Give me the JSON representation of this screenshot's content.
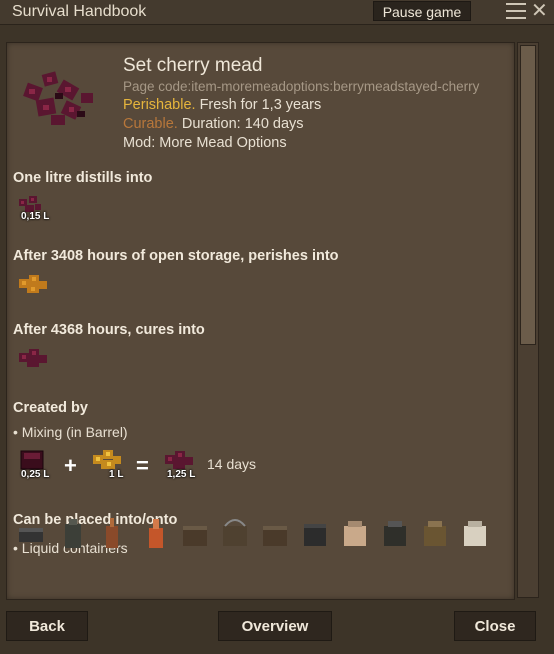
{
  "window": {
    "title": "Survival Handbook",
    "pause_label": "Pause game"
  },
  "item": {
    "name": "Set cherry mead",
    "page_code": "Page code:item-moremeadoptions:berrymeadstayed-cherry",
    "perishable_label": "Perishable.",
    "fresh_text": "Fresh for 1,3 years",
    "curable_label": "Curable.",
    "duration_text": "Duration: 140 days",
    "mod_text": "Mod: More Mead Options"
  },
  "sections": {
    "distills": {
      "heading": "One litre distills into",
      "qty": "0,15 L"
    },
    "perishes": {
      "heading": "After 3408 hours of open storage, perishes into"
    },
    "cures": {
      "heading": "After 4368 hours, cures into"
    },
    "created": {
      "heading": "Created by",
      "method": "• Mixing (in Barrel)",
      "ingredient1_qty": "0,25 L",
      "plus": "+",
      "ingredient2_qty": "1 L",
      "equals": "=",
      "result_qty": "1,25 L",
      "time": "14 days"
    },
    "placed": {
      "heading": "Can be placed into/onto",
      "subheading": "• Liquid containers",
      "icons": [
        "bowl-icon",
        "flask-icon",
        "still-icon",
        "lantern-flask-icon",
        "barrel-icon",
        "bucket-icon",
        "barrel-icon",
        "pot-icon",
        "jug-icon",
        "crock-icon",
        "crock-icon",
        "crock-icon",
        "crock-icon"
      ]
    }
  },
  "buttons": {
    "back": "Back",
    "overview": "Overview",
    "close": "Close"
  },
  "colors": {
    "perishable": "#e6b53c",
    "curable": "#b8773a",
    "accent": "#57493a"
  }
}
